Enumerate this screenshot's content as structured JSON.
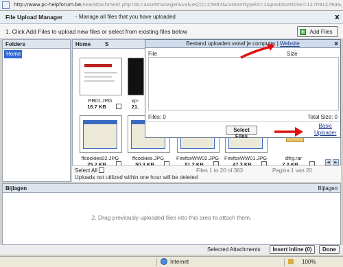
{
  "browser": {
    "url_host": "http://www.pc-helpforum.be",
    "url_rest": "/newattachment.php?do=assetmanager&values[t]=25987&contenttypeid=1&poststarttime=1270912784&pos",
    "zone": "Internet",
    "zoom": "100%"
  },
  "manager": {
    "title": "File Upload Manager",
    "subtitle": "- Manage all files that you have uploaded",
    "close": "x",
    "instruction": "1. Click Add Files to upload new files or select from existing files below",
    "add_files_label": "Add Files"
  },
  "folders": {
    "header": "Folders",
    "home": "Home"
  },
  "files": {
    "header": "Home",
    "header_trunc": "S",
    "select_all": "Select All",
    "count": "Files 1 to 20 of 383",
    "page": "Pagina 1 van 20",
    "warning": "Uploads not utilized within one hour will be deleted",
    "items": [
      {
        "name": "PB01.JPG",
        "size": "16.7 KB"
      },
      {
        "name": "xp-",
        "size": "21."
      },
      {
        "name": "ffcookies02.JPG",
        "size": "25.2 KB"
      },
      {
        "name": "ffcookies.JPG",
        "size": "50.3 KB"
      },
      {
        "name": "FirefoxWW02.JPG",
        "size": "51.2 KB"
      },
      {
        "name": "FirefoxWW01.JPG",
        "size": "47.3 KB"
      },
      {
        "name": "dfrg.rar",
        "size": "7.0 KB"
      }
    ]
  },
  "popup": {
    "title": "Bestand uploaden vanaf je computer |",
    "title_link": "Website",
    "close": "x",
    "col_file": "File",
    "col_size": "Size",
    "files_count": "Files: 0",
    "total_size": "Total Size: 0",
    "select_files": "Select Files",
    "basic_line1": "Basic",
    "basic_line2": "Uploader"
  },
  "bijlagen": {
    "header": "Bijlagen",
    "header_right": "Bijlagen",
    "instruction": "2. Drag previously uploaded files into this area to attach them."
  },
  "attachments": {
    "label": "Selected Attachments:",
    "insert_inline": "Insert Inline (0)",
    "done": "Done"
  },
  "colors": {
    "accent": "#3168d5",
    "arrow": "#e01010"
  }
}
